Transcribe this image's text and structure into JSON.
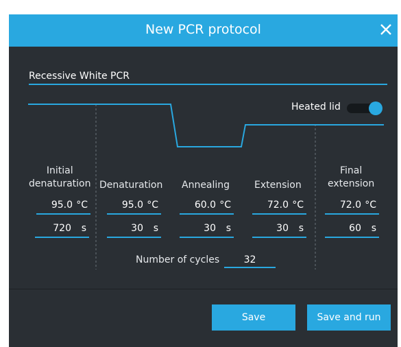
{
  "dialog": {
    "title": "New PCR protocol",
    "close_icon": "close-icon",
    "accent_color": "#29a8e0",
    "background_color": "#2a2f34"
  },
  "protocol_name": {
    "value": "Recessive White PCR"
  },
  "heated_lid": {
    "label": "Heated lid",
    "enabled": true
  },
  "steps": [
    {
      "label": "Initial denaturation",
      "temperature": "95.0",
      "temp_unit": "°C",
      "duration": "720",
      "time_unit": "s"
    },
    {
      "label": "Denaturation",
      "temperature": "95.0",
      "temp_unit": "°C",
      "duration": "30",
      "time_unit": "s"
    },
    {
      "label": "Annealing",
      "temperature": "60.0",
      "temp_unit": "°C",
      "duration": "30",
      "time_unit": "s"
    },
    {
      "label": "Extension",
      "temperature": "72.0",
      "temp_unit": "°C",
      "duration": "30",
      "time_unit": "s"
    },
    {
      "label": "Final extension",
      "temperature": "72.0",
      "temp_unit": "°C",
      "duration": "60",
      "time_unit": "s"
    }
  ],
  "cycles": {
    "label": "Number of cycles",
    "value": "32"
  },
  "buttons": {
    "save": "Save",
    "save_and_run": "Save and run"
  }
}
